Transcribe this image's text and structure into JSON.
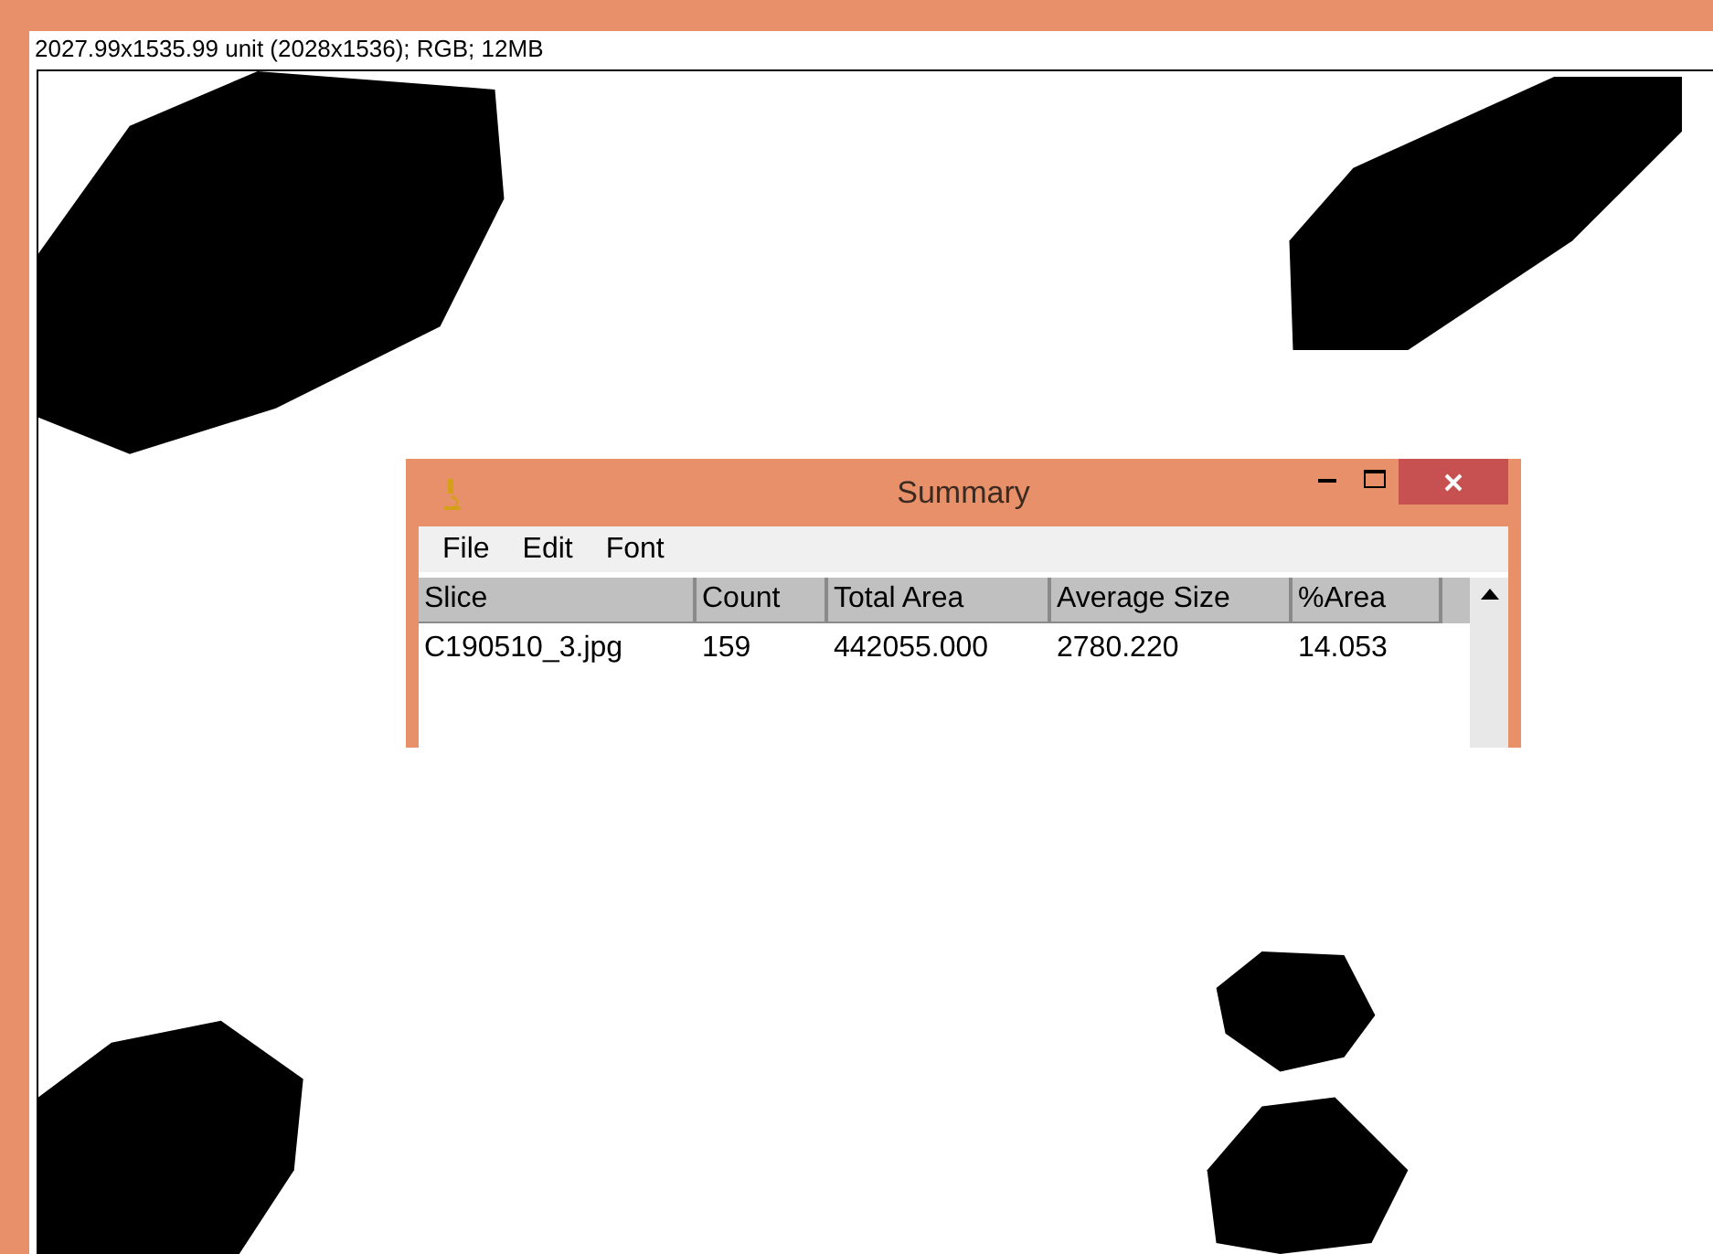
{
  "image_window": {
    "info": "2027.99x1535.99 unit (2028x1536); RGB; 12MB"
  },
  "summary_window": {
    "title": "Summary",
    "menu": [
      "File",
      "Edit",
      "Font"
    ],
    "table": {
      "columns": [
        "Slice",
        "Count",
        "Total Area",
        "Average Size",
        "%Area"
      ],
      "rows": [
        [
          "C190510_3.jpg",
          "159",
          "442055.000",
          "2780.220",
          "14.053"
        ]
      ]
    }
  }
}
